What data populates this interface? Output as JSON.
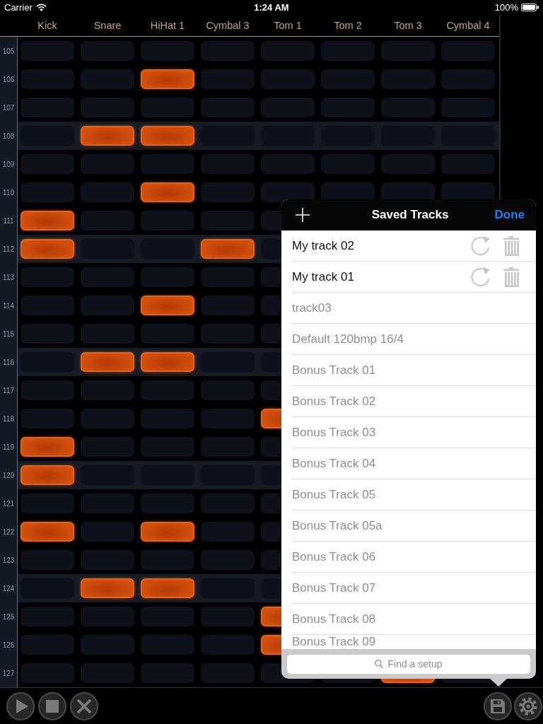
{
  "status_bar": {
    "carrier": "Carrier",
    "time": "1:24 AM",
    "battery": "100%"
  },
  "columns": [
    "Kick",
    "Snare",
    "HiHat 1",
    "Cymbal 3",
    "Tom 1",
    "Tom 2",
    "Tom 3",
    "Cymbal 4"
  ],
  "rows": [
    {
      "label": "105",
      "highlighted": false,
      "pads": [
        false,
        false,
        false,
        false,
        false,
        false,
        false,
        false
      ]
    },
    {
      "label": "106",
      "highlighted": false,
      "pads": [
        false,
        false,
        true,
        false,
        false,
        false,
        false,
        false
      ]
    },
    {
      "label": "107",
      "highlighted": false,
      "pads": [
        false,
        false,
        false,
        false,
        false,
        false,
        false,
        false
      ]
    },
    {
      "label": "108",
      "highlighted": true,
      "pads": [
        false,
        true,
        true,
        false,
        false,
        false,
        false,
        false
      ]
    },
    {
      "label": "109",
      "highlighted": false,
      "pads": [
        false,
        false,
        false,
        false,
        false,
        false,
        false,
        false
      ]
    },
    {
      "label": "110",
      "highlighted": false,
      "pads": [
        false,
        false,
        true,
        false,
        false,
        false,
        false,
        false
      ]
    },
    {
      "label": "111",
      "highlighted": false,
      "pads": [
        true,
        false,
        false,
        false,
        false
      ]
    },
    {
      "label": "112",
      "highlighted": true,
      "pads": [
        true,
        false,
        false,
        true,
        false
      ]
    },
    {
      "label": "113",
      "highlighted": false,
      "pads": [
        false,
        false,
        false,
        false,
        false
      ]
    },
    {
      "label": "114",
      "highlighted": false,
      "pads": [
        false,
        false,
        true,
        false,
        false
      ]
    },
    {
      "label": "115",
      "highlighted": false,
      "pads": [
        false,
        false,
        false,
        false,
        false
      ]
    },
    {
      "label": "116",
      "highlighted": true,
      "pads": [
        false,
        true,
        true,
        false,
        false
      ]
    },
    {
      "label": "117",
      "highlighted": false,
      "pads": [
        false,
        false,
        false,
        false,
        false
      ]
    },
    {
      "label": "118",
      "highlighted": false,
      "pads": [
        false,
        false,
        false,
        false,
        true
      ]
    },
    {
      "label": "119",
      "highlighted": false,
      "pads": [
        true,
        false,
        false,
        false,
        false
      ]
    },
    {
      "label": "120",
      "highlighted": true,
      "pads": [
        true,
        false,
        false,
        false,
        false
      ]
    },
    {
      "label": "121",
      "highlighted": false,
      "pads": [
        false,
        false,
        false,
        false,
        false
      ]
    },
    {
      "label": "122",
      "highlighted": false,
      "pads": [
        true,
        false,
        true,
        false,
        false
      ]
    },
    {
      "label": "123",
      "highlighted": false,
      "pads": [
        false,
        false,
        false,
        false,
        false
      ]
    },
    {
      "label": "124",
      "highlighted": true,
      "pads": [
        false,
        true,
        true,
        false,
        false
      ]
    },
    {
      "label": "125",
      "highlighted": false,
      "pads": [
        false,
        false,
        false,
        false,
        true
      ]
    },
    {
      "label": "126",
      "highlighted": false,
      "pads": [
        false,
        false,
        false,
        false,
        true
      ]
    },
    {
      "label": "127",
      "highlighted": false,
      "pads": [
        false,
        false,
        false,
        false,
        false,
        false,
        true,
        false
      ]
    }
  ],
  "toolbar": {
    "transport": [
      {
        "kind": "play"
      },
      {
        "kind": "stop"
      },
      {
        "kind": "clear"
      }
    ],
    "tools": [
      {
        "kind": "save"
      },
      {
        "kind": "settings"
      }
    ]
  },
  "popover": {
    "title": "Saved Tracks",
    "done": "Done",
    "tracks": [
      {
        "name": "My track 02",
        "editable": true
      },
      {
        "name": "My track 01",
        "editable": true
      },
      {
        "name": "track03",
        "editable": false
      },
      {
        "name": "Default 120bmp 16/4",
        "editable": false
      },
      {
        "name": "Bonus Track 01",
        "editable": false
      },
      {
        "name": "Bonus Track 02",
        "editable": false
      },
      {
        "name": "Bonus Track 03",
        "editable": false
      },
      {
        "name": "Bonus Track 04",
        "editable": false
      },
      {
        "name": "Bonus Track 05",
        "editable": false
      },
      {
        "name": "Bonus Track 05a",
        "editable": false
      },
      {
        "name": "Bonus Track 06",
        "editable": false
      },
      {
        "name": "Bonus Track 07",
        "editable": false
      },
      {
        "name": "Bonus Track 08",
        "editable": false
      },
      {
        "name": "Bonus Track 09",
        "editable": false
      }
    ],
    "search": {
      "placeholder": "Find a setup"
    }
  }
}
